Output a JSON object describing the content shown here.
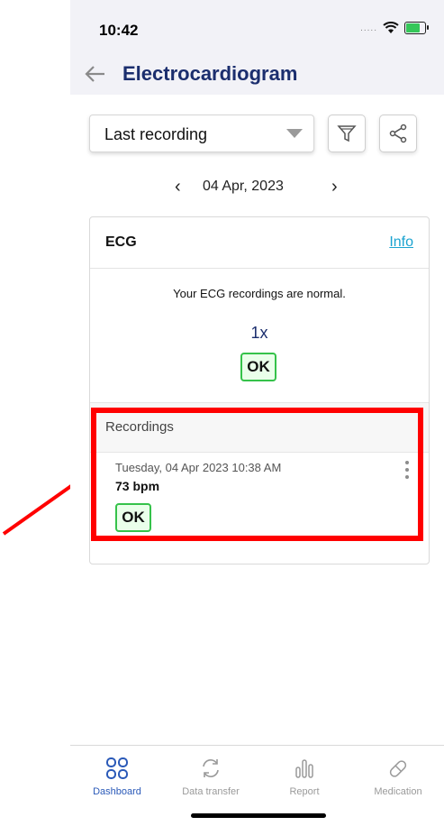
{
  "status_bar": {
    "time": "10:42",
    "signal": "....."
  },
  "header": {
    "title": "Electrocardiogram"
  },
  "filter": {
    "selected": "Last recording"
  },
  "date_nav": {
    "date": "04 Apr, 2023",
    "prev": "‹",
    "next": "›"
  },
  "ecg_card": {
    "title": "ECG",
    "info_link": "Info",
    "summary": "Your ECG recordings are normal.",
    "count": "1x",
    "status": "OK"
  },
  "recordings": {
    "title": "Recordings",
    "items": [
      {
        "datetime": "Tuesday, 04 Apr 2023 10:38 AM",
        "bpm": "73 bpm",
        "status": "OK"
      }
    ]
  },
  "tabs": [
    {
      "label": "Dashboard",
      "icon": "dashboard-icon"
    },
    {
      "label": "Data transfer",
      "icon": "sync-icon"
    },
    {
      "label": "Report",
      "icon": "report-icon"
    },
    {
      "label": "Medication",
      "icon": "pill-icon"
    }
  ],
  "colors": {
    "accent": "#2a59b8",
    "title": "#1b2e6e",
    "ok_border": "#35c24a",
    "highlight": "#ff0000",
    "link": "#1aa3d0"
  }
}
